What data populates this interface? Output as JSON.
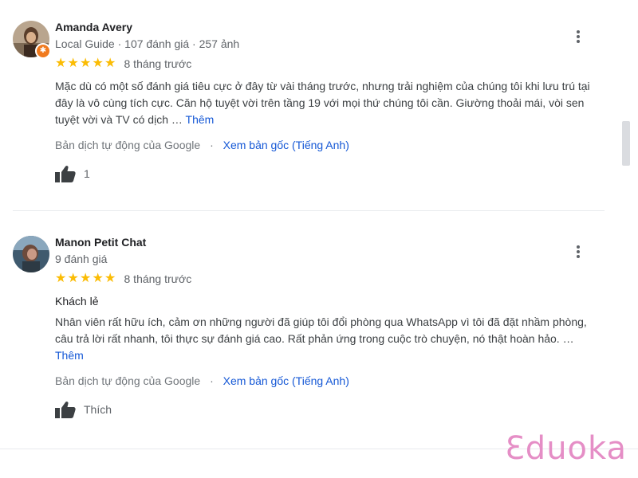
{
  "reviews": [
    {
      "name": "Amanda Avery",
      "guide_label": "Local Guide",
      "meta_stats": "· 107 đánh giá · 257 ảnh",
      "rating": 5,
      "time": "8 tháng trước",
      "subtitle": "",
      "text": "Mặc dù có một số đánh giá tiêu cực ở đây từ vài tháng trước, nhưng trải nghiệm của chúng tôi khi lưu trú tại đây là vô cùng tích cực. Căn hộ tuyệt vời trên tầng 19 với mọi thứ chúng tôi cần. Giường thoải mái, vòi sen tuyệt vời và TV có dịch …",
      "more_label": "Thêm",
      "translation_label": "Bản dịch tự động của Google",
      "translation_separator": "·",
      "see_original": "Xem bản gốc (Tiếng Anh)",
      "like_label": "1"
    },
    {
      "name": "Manon Petit Chat",
      "guide_label": "",
      "meta_stats": "9 đánh giá",
      "rating": 5,
      "time": "8 tháng trước",
      "subtitle": "Khách lẻ",
      "text": "Nhân viên rất hữu ích, cảm ơn những người đã giúp tôi đổi phòng qua WhatsApp vì tôi đã đặt nhầm phòng, câu trả lời rất nhanh, tôi thực sự đánh giá cao. Rất phản ứng trong cuộc trò chuyện, nó thật hoàn hảo. …",
      "more_label": "Thêm",
      "translation_label": "Bản dịch tự động của Google",
      "translation_separator": "·",
      "see_original": "Xem bản gốc (Tiếng Anh)",
      "like_label": "Thích"
    }
  ],
  "star_glyph": "★",
  "icons": {
    "menu": "more-vert-icon",
    "like": "thumb-up-icon",
    "badge": "local-guide-badge-icon"
  },
  "colors": {
    "star": "#fbbc04",
    "link": "#1558d6",
    "badge": "#f07a1e",
    "watermark": "#e58ec6"
  },
  "watermark": "Ɛduoka"
}
